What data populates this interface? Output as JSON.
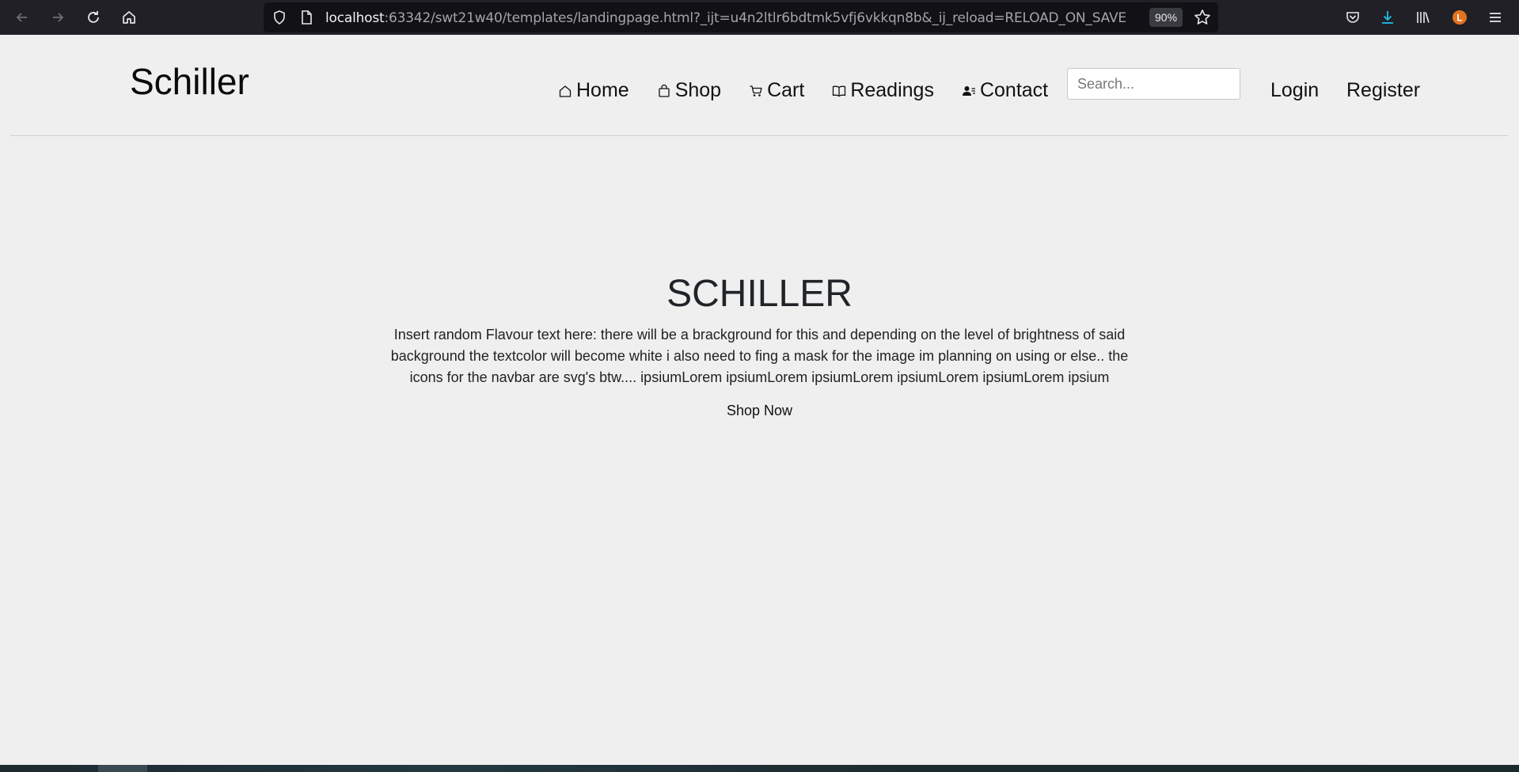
{
  "browser": {
    "url_host": "localhost",
    "url_rest": ":63342/swt21w40/templates/landingpage.html?_ijt=u4n2ltlr6bdtmk5vfj6vkkqn8b&_ij_reload=RELOAD_ON_SAVE",
    "zoom": "90%",
    "account_initial": "L",
    "accent_color": "#1fb8e0",
    "account_color": "#e2731f"
  },
  "header": {
    "logo": "Schiller",
    "nav": [
      {
        "label": "Home",
        "icon": "home-icon"
      },
      {
        "label": "Shop",
        "icon": "bag-icon"
      },
      {
        "label": "Cart",
        "icon": "cart-icon"
      },
      {
        "label": "Readings",
        "icon": "book-icon"
      },
      {
        "label": "Contact",
        "icon": "contact-icon"
      }
    ],
    "search_placeholder": "Search...",
    "login": "Login",
    "register": "Register"
  },
  "hero": {
    "title": "SCHILLER",
    "text": "Insert random Flavour text here: there will be a brackground for this and depending on the level of brightness of said background the textcolor will become white i also need to fing a mask for the image im planning on using or else.. the icons for the navbar are svg's btw.... ipsiumLorem ipsiumLorem ipsiumLorem ipsiumLorem ipsiumLorem ipsium",
    "button": "Shop Now"
  }
}
